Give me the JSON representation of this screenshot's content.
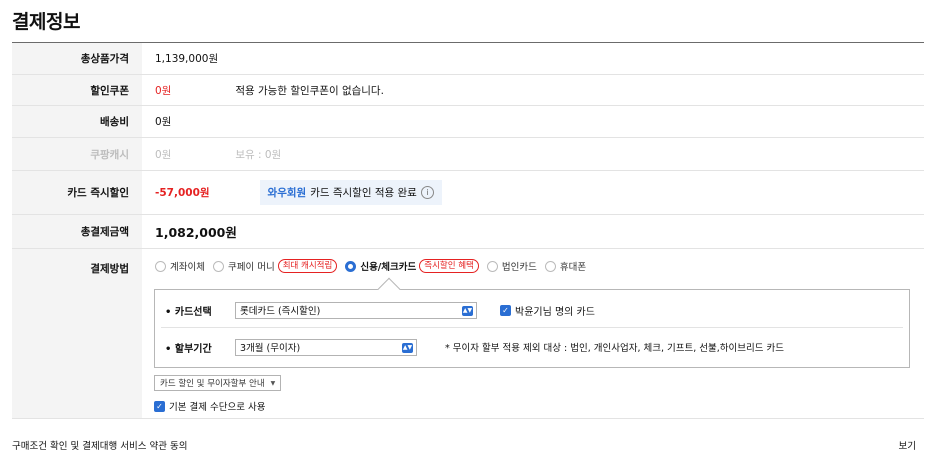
{
  "page_title": "결제정보",
  "rows": {
    "product_total": {
      "label": "총상품가격",
      "value": "1,139,000원"
    },
    "coupon": {
      "label": "할인쿠폰",
      "value": "0원",
      "note": "적용 가능한 할인쿠폰이 없습니다."
    },
    "shipping": {
      "label": "배송비",
      "value": "0원"
    },
    "cash": {
      "label": "쿠팡캐시",
      "value": "0원",
      "note": "보유 : 0원"
    },
    "card_discount": {
      "label": "카드 즉시할인",
      "value": "-57,000원",
      "wow": "와우회원",
      "note": "카드 즉시할인 적용 완료"
    },
    "total": {
      "label": "총결제금액",
      "value": "1,082,000원"
    },
    "payment": {
      "label": "결제방법"
    }
  },
  "payment_methods": [
    {
      "label": "계좌이체",
      "selected": false,
      "tag": ""
    },
    {
      "label": "쿠페이 머니",
      "selected": false,
      "tag": "최대 캐시적립"
    },
    {
      "label": "신용/체크카드",
      "selected": true,
      "tag": "즉시할인 혜택"
    },
    {
      "label": "법인카드",
      "selected": false,
      "tag": ""
    },
    {
      "label": "휴대폰",
      "selected": false,
      "tag": ""
    }
  ],
  "card_panel": {
    "card_label": "• 카드선택",
    "card_value": "롯데카드 (즉시할인)",
    "owner_label": "박윤기님 명의 카드",
    "installment_label": "• 할부기간",
    "installment_value": "3개월 (무이자)",
    "installment_note": "* 무이자 할부 적용 제외 대상 : 법인, 개인사업자, 체크, 기프트, 선불,하이브리드 카드"
  },
  "guide_button": "카드 할인 및 무이자할부 안내",
  "default_method": "기본 결제 수단으로 사용",
  "agree_text": "구매조건 확인 및 결제대행 서비스 약관 동의",
  "view_link": "보기",
  "colors": {
    "accent": "#2a6ed3",
    "red": "#e52222"
  }
}
